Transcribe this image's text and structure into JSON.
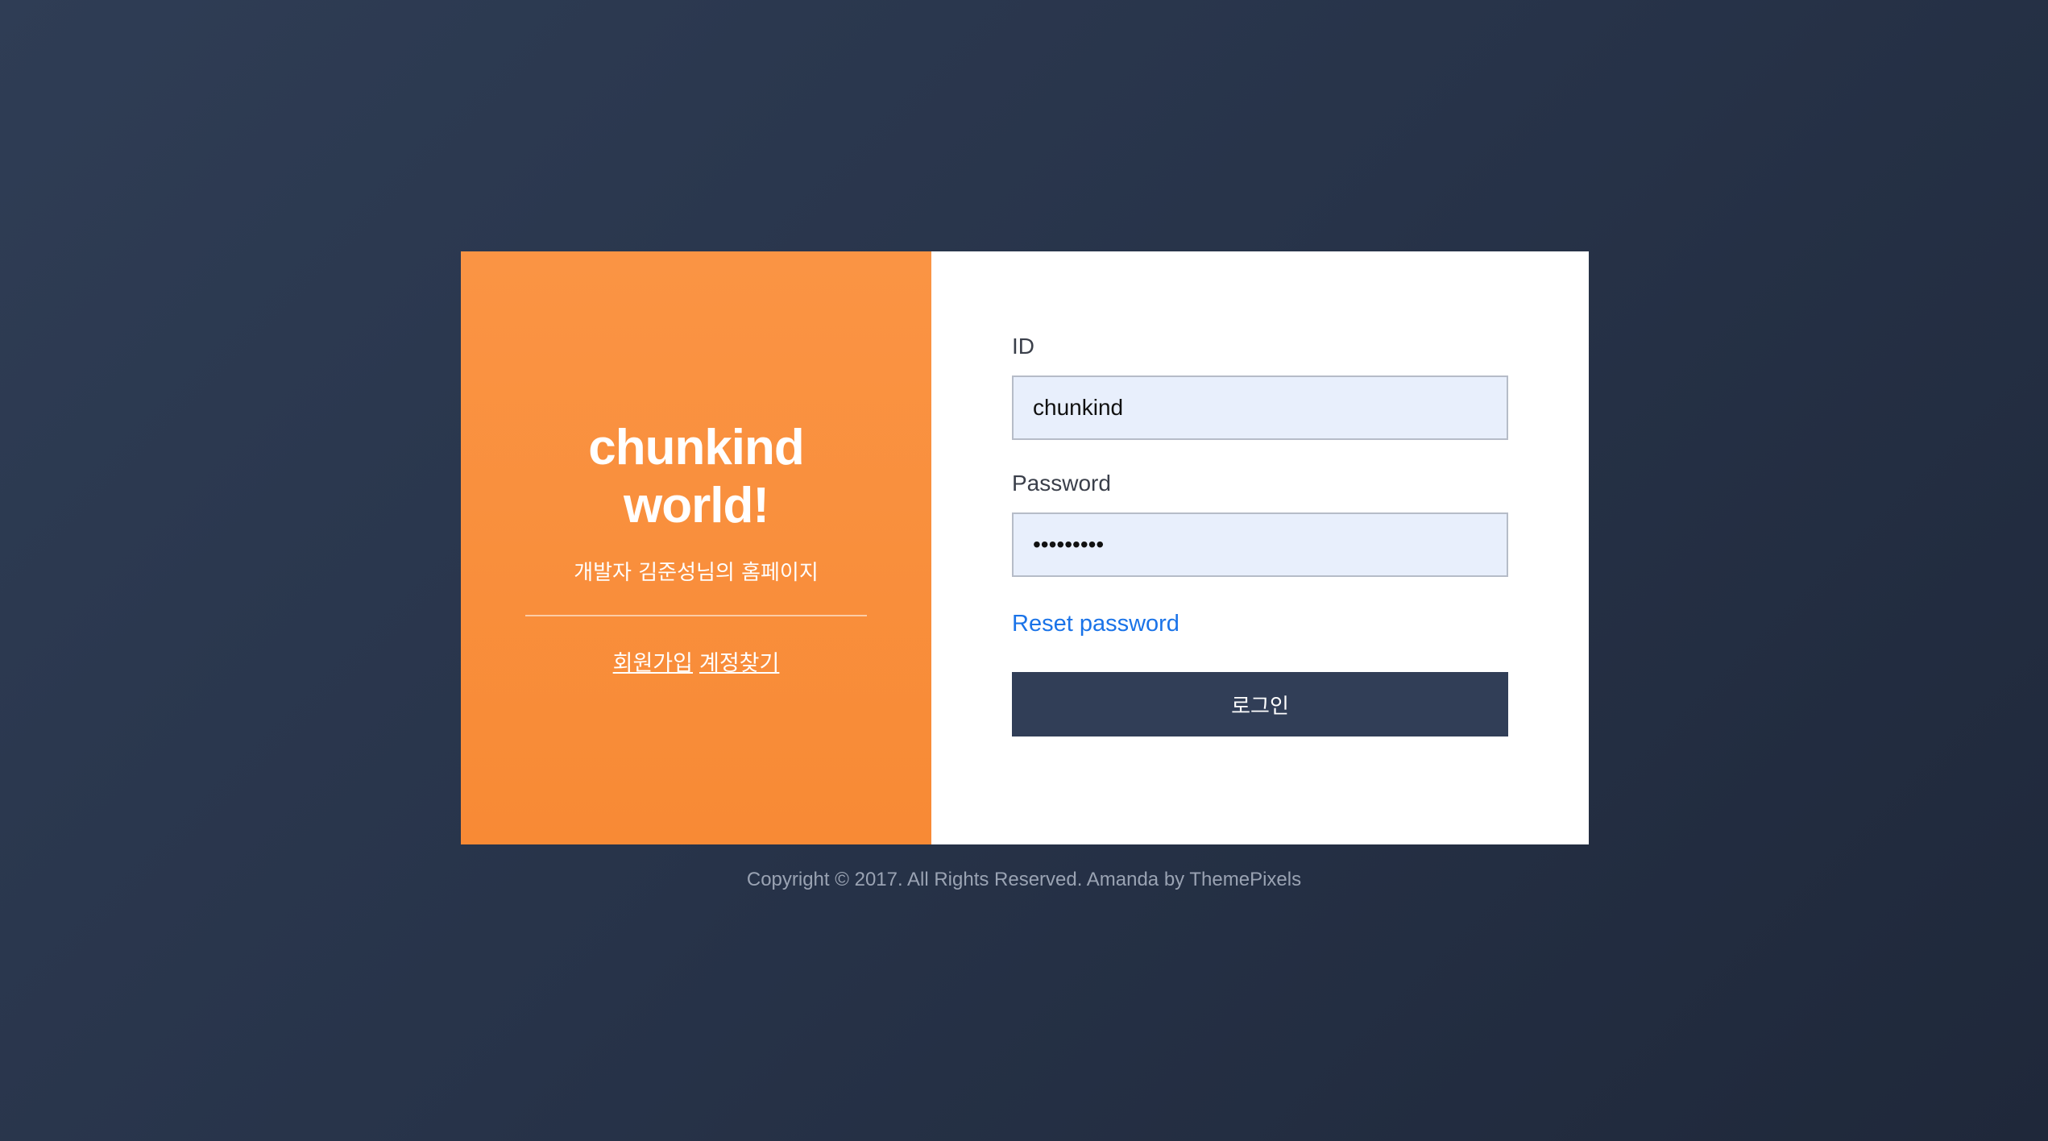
{
  "brand": {
    "title_line1": "chunkind",
    "title_line2": "world!",
    "subtitle": "개발자 김준성님의 홈페이지",
    "signup_link": "회원가입",
    "find_account_link": "계정찾기",
    "color": "#fa9444"
  },
  "form": {
    "id_label": "ID",
    "id_value": "chunkind",
    "password_label": "Password",
    "password_value": "•••••••••",
    "reset_password_link": "Reset password",
    "login_button": "로그인",
    "button_color": "#313e57",
    "input_bg_color": "#e8effc",
    "link_color": "#1a73e8"
  },
  "footer": {
    "copyright": "Copyright © 2017. All Rights Reserved. Amanda by ThemePixels"
  }
}
